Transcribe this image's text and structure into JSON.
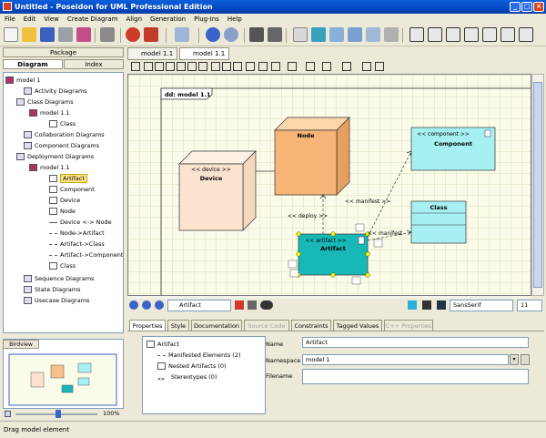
{
  "window": {
    "title": "Untitled - Poseidon for UML Professional Edition"
  },
  "menu": [
    "File",
    "Edit",
    "View",
    "Create Diagram",
    "Align",
    "Generation",
    "Plug-Ins",
    "Help"
  ],
  "left_tabs": {
    "package": "Package",
    "diagram": "Diagram",
    "index": "Index"
  },
  "tree": {
    "model": "model 1",
    "items": [
      {
        "label": "Activity Diagrams"
      },
      {
        "label": "Class Diagrams"
      },
      {
        "label": "model 1.1"
      },
      {
        "label": "Class"
      },
      {
        "label": "Collaboration Diagrams"
      },
      {
        "label": "Component Diagrams"
      },
      {
        "label": "Deployment Diagrams"
      },
      {
        "label": "model 1.1"
      },
      {
        "label": "Artifact"
      },
      {
        "label": "Component"
      },
      {
        "label": "Device"
      },
      {
        "label": "Node"
      },
      {
        "label": "Device <-> Node"
      },
      {
        "label": "Node->Artifact"
      },
      {
        "label": "Artifact->Class"
      },
      {
        "label": "Artifact->Component"
      },
      {
        "label": "Class"
      },
      {
        "label": "Sequence Diagrams"
      },
      {
        "label": "State Diagrams"
      },
      {
        "label": "Usecase Diagrams"
      }
    ]
  },
  "birdview": {
    "tab": "Birdview",
    "zoom": "100%"
  },
  "doc_tabs": [
    "model 1.1",
    "model 1.1"
  ],
  "diagram": {
    "frame_label": "dd: model 1.1",
    "node_label": "Node",
    "device_stereo": "<< device >>",
    "device_name": "Device",
    "component_stereo": "<< component >>",
    "component_name": "Component",
    "class_name": "Class",
    "artifact_stereo": "<< artifact >>",
    "artifact_name": "Artifact",
    "deploy_label": "<< deploy >>",
    "manifest_label_1": "<< manifest >>",
    "manifest_label_2": "<< manifest"
  },
  "navbar": {
    "current": "Artifact",
    "font": "SansSerif",
    "size": "11"
  },
  "prop_tabs": [
    "Properties",
    "Style",
    "Documentation",
    "Source Code",
    "Constraints",
    "Tagged Values",
    "C++ Properties"
  ],
  "props_tree": {
    "root": "Artifact",
    "items": [
      "Manifested Elements (2)",
      "Nested Artifacts (0)",
      "Stereotypes (0)"
    ]
  },
  "fields": {
    "name_label": "Name",
    "name_value": "Artifact",
    "namespace_label": "Namespace",
    "namespace_value": "model 1",
    "filename_label": "Filename",
    "filename_value": ""
  },
  "status": {
    "text": "Drag model element"
  }
}
